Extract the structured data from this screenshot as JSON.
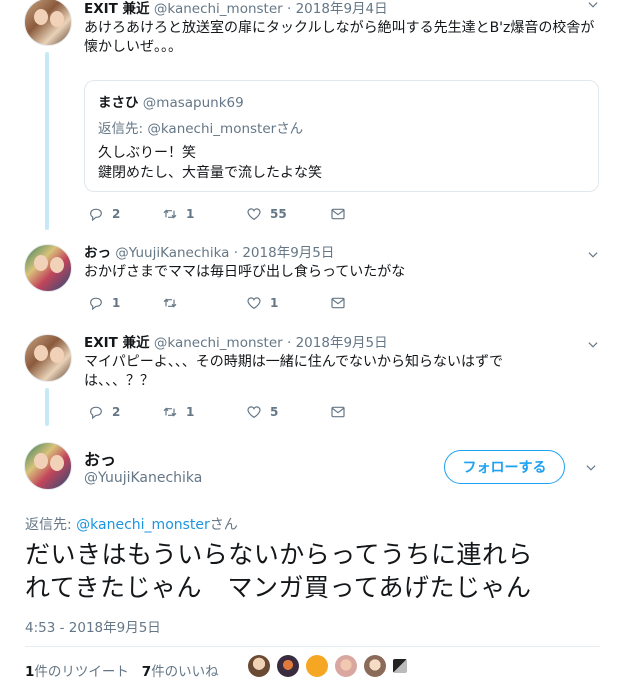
{
  "tweets": [
    {
      "name": "EXIT 兼近",
      "handle": "@kanechi_monster",
      "dot": "·",
      "date": "2018年9月4日",
      "text": "あけろあけろと放送室の扉にタックルしながら絶叫する先生達とB'z爆音の校舎が懐かしいぜ。。。",
      "quote": {
        "name": "まさひ",
        "handle": "@masapunk69",
        "reply_prefix": "返信先: ",
        "reply_mention": "@kanechi_monster",
        "reply_suffix": "さん",
        "lines": [
          "久しぶりー！笑",
          "鍵閉めたし、大音量で流したよな笑"
        ]
      },
      "replies": "2",
      "retweets": "1",
      "likes": "55"
    },
    {
      "name": "おっ",
      "handle": "@YuujiKanechika",
      "dot": "·",
      "date": "2018年9月5日",
      "text": "おかげさまでママは毎日呼び出し食らっていたがな",
      "replies": "1",
      "retweets": "",
      "likes": "1"
    },
    {
      "name": "EXIT 兼近",
      "handle": "@kanechi_monster",
      "dot": "·",
      "date": "2018年9月5日",
      "text": "マイパピーよ、、、その時期は一緒に住んでないから知らないはずでは、、、？？",
      "replies": "2",
      "retweets": "1",
      "likes": "5"
    }
  ],
  "main": {
    "name": "おっ",
    "handle": "@YuujiKanechika",
    "follow_label": "フォローする",
    "reply_prefix": "返信先: ",
    "reply_mention": "@kanechi_monster",
    "reply_suffix": "さん",
    "text_line1": "だいきはもういらないからってうちに連れら",
    "text_line2": "れてきたじゃん　マンガ買ってあげたじゃん",
    "timestamp": "4:53 - 2018年9月5日",
    "retweet_count": "1",
    "retweet_label": "件のリツイート",
    "like_count": "7",
    "like_label": "件のいいね"
  },
  "icons": [
    "reply-icon",
    "retweet-icon",
    "heart-icon",
    "message-icon",
    "chevron-down-icon"
  ],
  "colors": {
    "accent": "#1da1f2",
    "muted": "#657786",
    "thread": "#c4eaf7"
  }
}
